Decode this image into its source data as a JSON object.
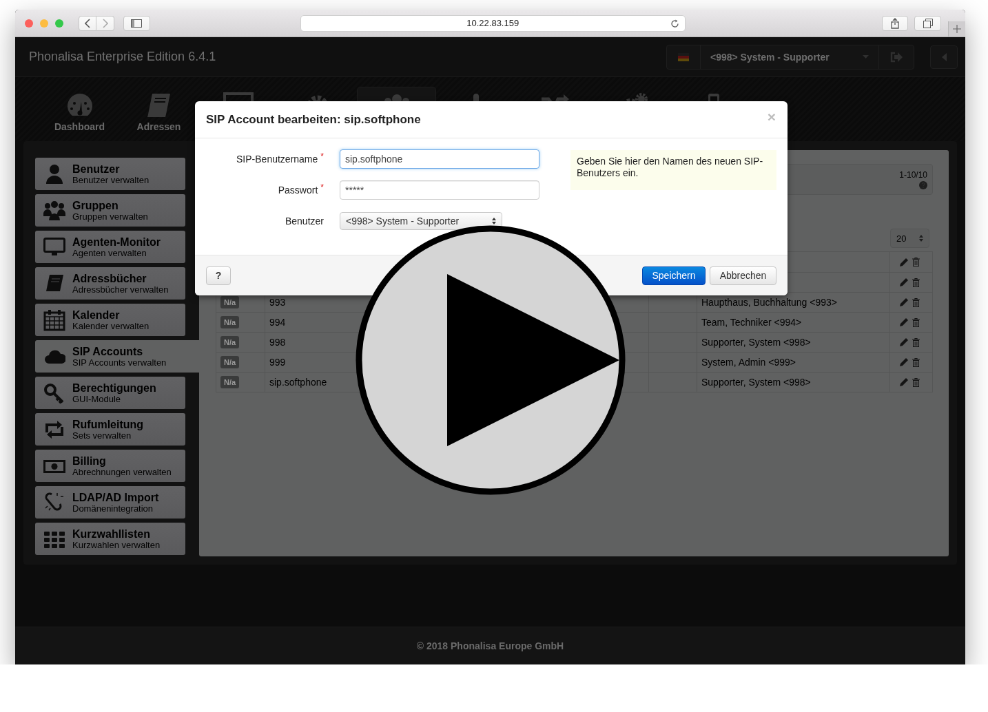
{
  "browser": {
    "address": "10.22.83.159"
  },
  "app": {
    "title": "Phonalisa Enterprise Edition 6.4.1",
    "user_menu": "<998> System - Supporter"
  },
  "nav": [
    {
      "label": "Dashboard",
      "selected": false
    },
    {
      "label": "Adressen",
      "selected": false
    },
    {
      "selected": false
    },
    {
      "selected": false
    },
    {
      "selected": true
    },
    {
      "selected": false
    },
    {
      "selected": false
    },
    {
      "selected": false
    },
    {
      "selected": false
    }
  ],
  "sidebar": {
    "items": [
      {
        "title": "Benutzer",
        "subtitle": "Benutzer verwalten",
        "selected": false
      },
      {
        "title": "Gruppen",
        "subtitle": "Gruppen verwalten",
        "selected": false
      },
      {
        "title": "Agenten-Monitor",
        "subtitle": "Agenten verwalten",
        "selected": false
      },
      {
        "title": "Adressbücher",
        "subtitle": "Adressbücher verwalten",
        "selected": false
      },
      {
        "title": "Kalender",
        "subtitle": "Kalender verwalten",
        "selected": false
      },
      {
        "title": "SIP Accounts",
        "subtitle": "SIP Accounts verwalten",
        "selected": true
      },
      {
        "title": "Berechtigungen",
        "subtitle": "GUI-Module",
        "selected": false
      },
      {
        "title": "Rufumleitung",
        "subtitle": "Sets verwalten",
        "selected": false
      },
      {
        "title": "Billing",
        "subtitle": "Abrechnungen verwalten",
        "selected": false
      },
      {
        "title": "LDAP/AD Import",
        "subtitle": "Domänenintegration",
        "selected": false
      },
      {
        "title": "Kurzwahllisten",
        "subtitle": "Kurzwahlen verwalten",
        "selected": false
      }
    ]
  },
  "content": {
    "range": "1-10/10",
    "page_size": "20",
    "table": {
      "rows": [
        {},
        {},
        {
          "status": "N/a",
          "name": "993",
          "user": "Haupthaus, Buchhaltung <993>"
        },
        {
          "status": "N/a",
          "name": "994",
          "user": "Team, Techniker <994>"
        },
        {
          "status": "N/a",
          "name": "998",
          "user": "Supporter, System <998>"
        },
        {
          "status": "N/a",
          "name": "999",
          "user": "System, Admin <999>"
        },
        {
          "status": "N/a",
          "name": "sip.softphone",
          "user": "Supporter, System <998>"
        }
      ]
    }
  },
  "dialog": {
    "title": "SIP Account bearbeiten: sip.softphone",
    "close": "×",
    "fields": [
      {
        "kind": "text",
        "label": "SIP-Benutzername",
        "required_mark": "*",
        "value": "sip.softphone",
        "focused": true
      },
      {
        "kind": "text",
        "label": "Passwort",
        "required_mark": "*",
        "value": "*****",
        "focused": false
      },
      {
        "kind": "select",
        "label": "Benutzer",
        "value": "<998> System - Supporter"
      }
    ],
    "help": "Geben Sie hier den Namen des neuen SIP-Benutzers ein.",
    "help_button": "?",
    "save_button": "Speichern",
    "cancel_button": "Abbrechen"
  },
  "footer": {
    "text": "© 2018 Phonalisa Europe GmbH"
  }
}
